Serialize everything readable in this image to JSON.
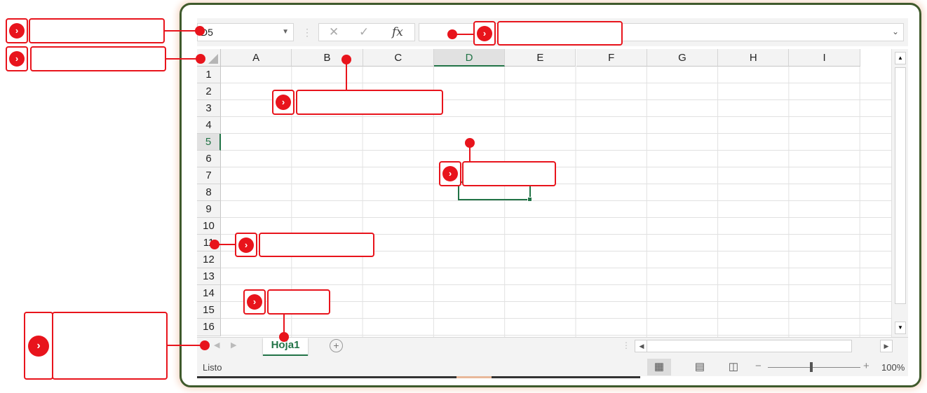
{
  "formula_bar": {
    "name_box": "D5",
    "cancel_icon": "✕",
    "enter_icon": "✓",
    "function_icon": "fx",
    "formula_value": ""
  },
  "columns": [
    "A",
    "B",
    "C",
    "D",
    "E",
    "F",
    "G",
    "H",
    "I"
  ],
  "selected_column": "D",
  "rows": [
    "1",
    "2",
    "3",
    "4",
    "5",
    "6",
    "7",
    "8",
    "9",
    "10",
    "11",
    "12",
    "13",
    "14",
    "15",
    "16"
  ],
  "selected_row": "5",
  "sheet_tabs": {
    "active": "Hoja1",
    "add_icon": "+"
  },
  "status_bar": {
    "ready": "Listo",
    "zoom": "100%"
  },
  "colors": {
    "accent": "#217346",
    "annotation_red": "#e8141c",
    "frame": "#3f5a2c"
  }
}
